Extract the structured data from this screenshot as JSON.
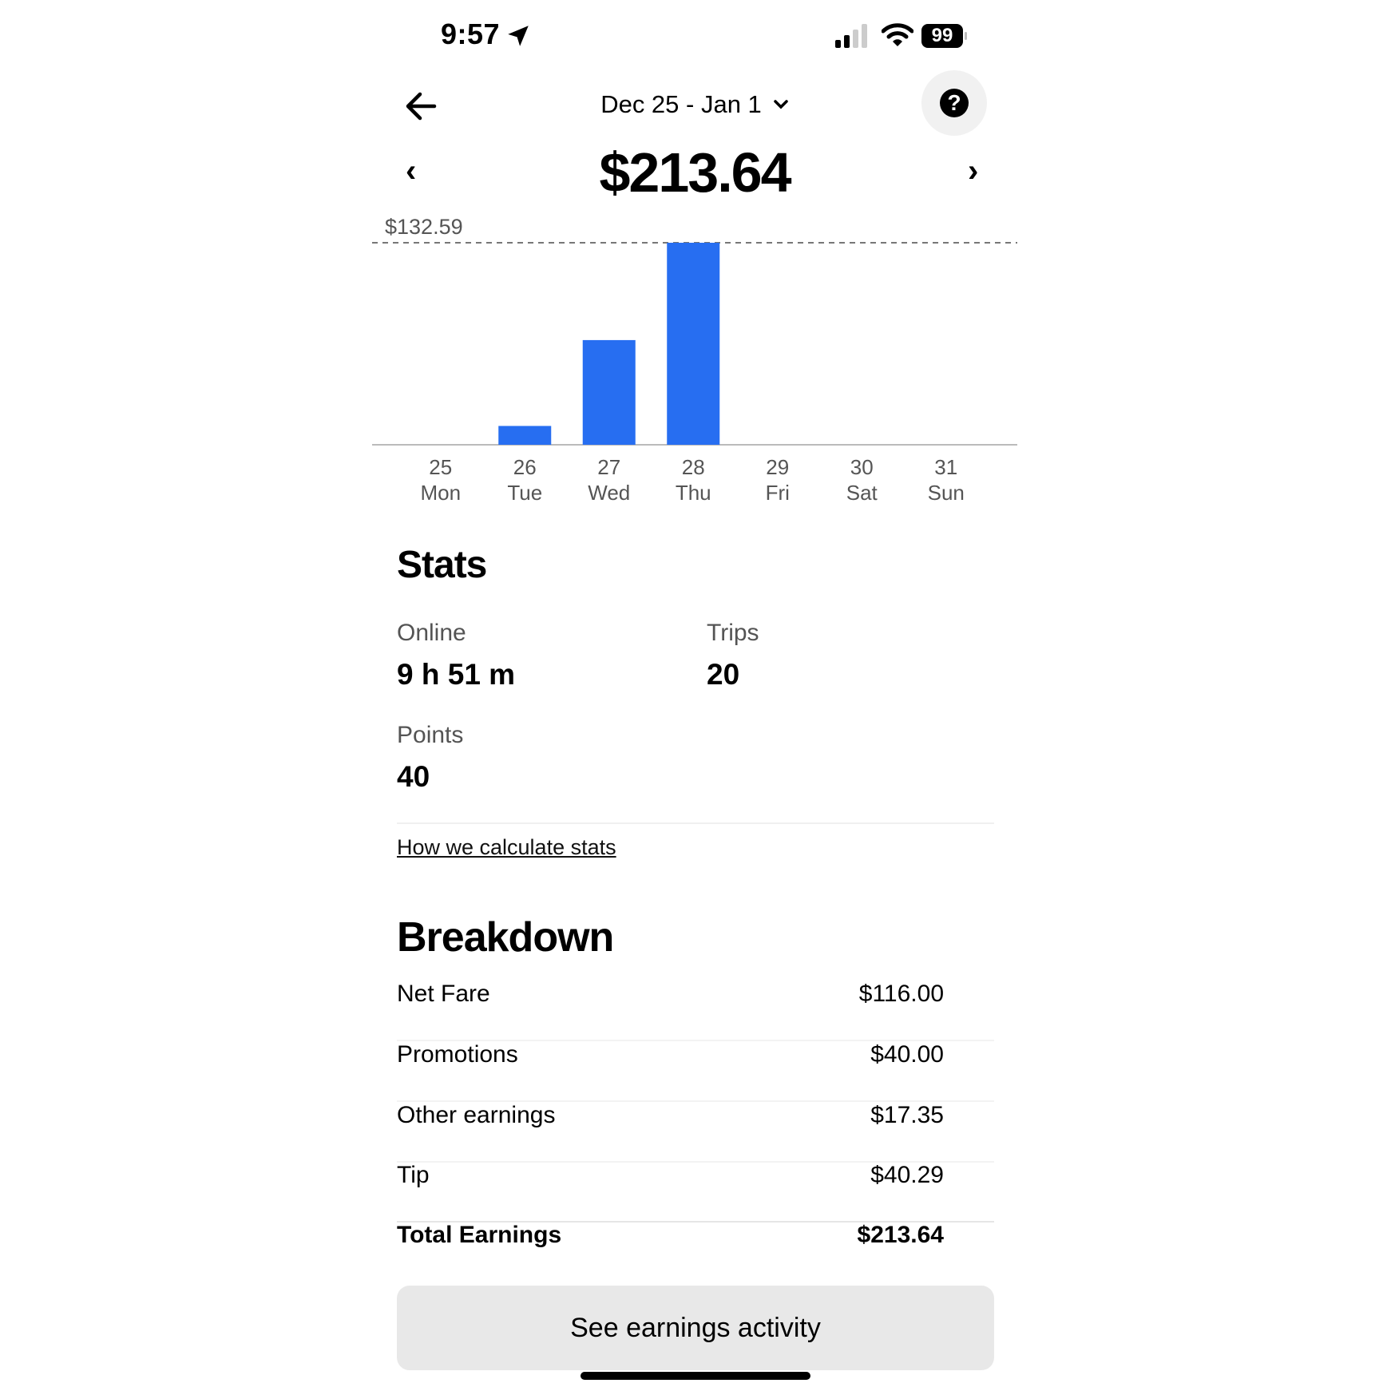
{
  "status_bar": {
    "time": "9:57",
    "battery": "99"
  },
  "header": {
    "date_range": "Dec 25 - Jan 1",
    "total_amount": "$213.64",
    "prev_symbol": "‹",
    "next_symbol": "›"
  },
  "chart_data": {
    "type": "bar",
    "title": "",
    "xlabel": "",
    "ylabel": "",
    "reference_line": {
      "label": "$132.59",
      "value": 132.59
    },
    "categories": [
      "25 Mon",
      "26 Tue",
      "27 Wed",
      "28 Thu",
      "29 Fri",
      "30 Sat",
      "31 Sun"
    ],
    "tick_days": [
      "25",
      "26",
      "27",
      "28",
      "29",
      "30",
      "31"
    ],
    "tick_weekdays": [
      "Mon",
      "Tue",
      "Wed",
      "Thu",
      "Fri",
      "Sat",
      "Sun"
    ],
    "values": [
      0,
      12.35,
      68.7,
      132.59,
      0,
      0,
      0
    ],
    "ylim": [
      0,
      132.59
    ],
    "bar_color": "#276EF1",
    "grid": false
  },
  "stats": {
    "title": "Stats",
    "online_label": "Online",
    "online_value": "9 h 51 m",
    "trips_label": "Trips",
    "trips_value": "20",
    "points_label": "Points",
    "points_value": "40",
    "how_link": "How we calculate stats"
  },
  "breakdown": {
    "title": "Breakdown",
    "rows": [
      {
        "name": "Net Fare",
        "amount": "$116.00"
      },
      {
        "name": "Promotions",
        "amount": "$40.00"
      },
      {
        "name": "Other earnings",
        "amount": "$17.35"
      },
      {
        "name": "Tip",
        "amount": "$40.29"
      },
      {
        "name": "Total Earnings",
        "amount": "$213.64"
      }
    ]
  },
  "actions": {
    "see_activity": "See earnings activity"
  }
}
